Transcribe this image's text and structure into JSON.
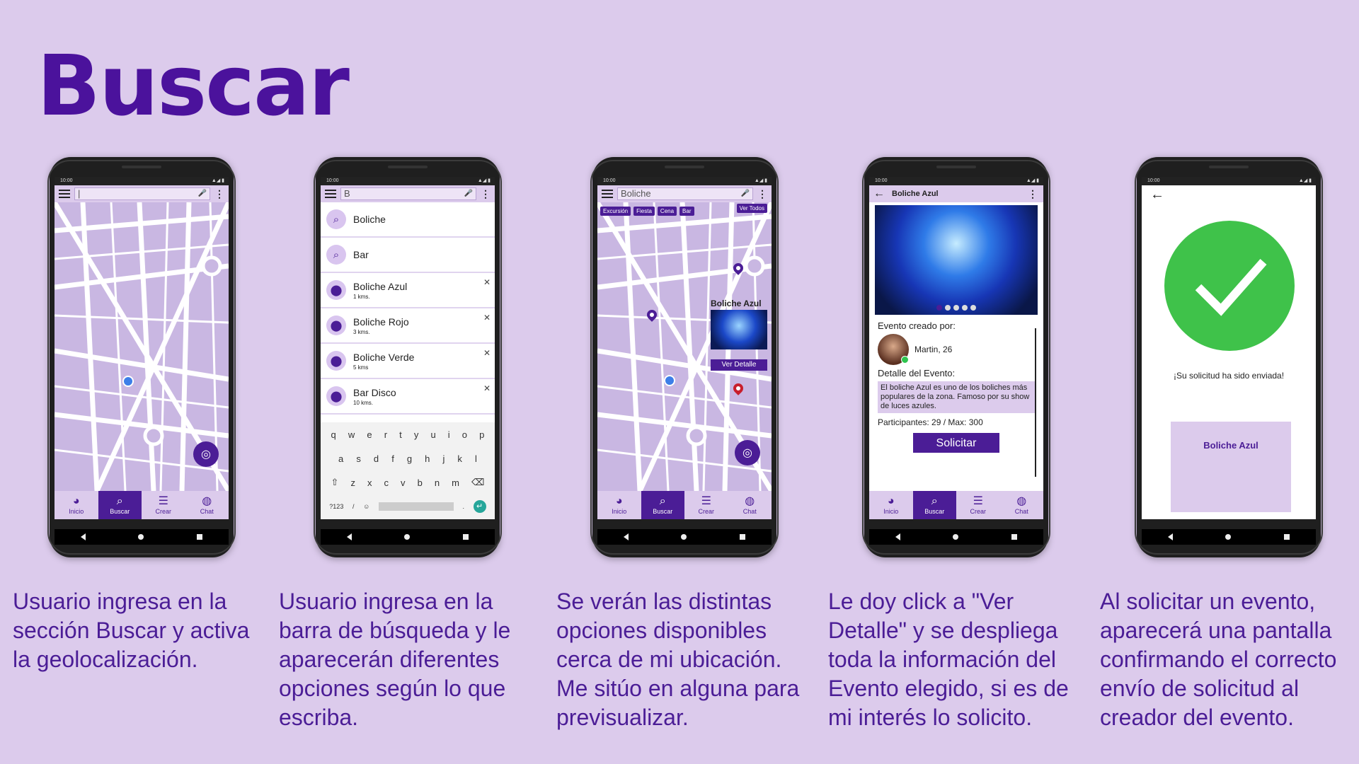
{
  "page_title": "Buscar",
  "captions": [
    "Usuario ingresa en la sección Buscar y activa la geolocalización.",
    "Usuario ingresa en la barra de búsqueda y le aparecerán diferentes opciones según lo que escriba.",
    "Se verán las distintas opciones disponibles cerca de mi ubicación. Me sitúo en alguna para previsualizar.",
    "Le doy click a \"Ver Detalle\" y se despliega toda la información del Evento elegido, si es de mi interés lo solicito.",
    "Al solicitar un evento, aparecerá una pantalla confirmando el correcto envío de solicitud al creador del evento."
  ],
  "status_time": "10:00",
  "bottom_nav": [
    "Inicio",
    "Buscar",
    "Crear",
    "Chat"
  ],
  "phone1": {
    "search_value": "|"
  },
  "phone2": {
    "search_value": "B",
    "suggestions": [
      {
        "label": "Boliche",
        "sub": ""
      },
      {
        "label": "Bar",
        "sub": ""
      },
      {
        "label": "Boliche Azul",
        "sub": "1 kms."
      },
      {
        "label": "Boliche Rojo",
        "sub": "3 kms."
      },
      {
        "label": "Boliche Verde",
        "sub": "5 kms"
      },
      {
        "label": "Bar Disco",
        "sub": "10 kms."
      }
    ],
    "keyboard_rows": [
      [
        "q",
        "w",
        "e",
        "r",
        "t",
        "y",
        "u",
        "i",
        "o",
        "p"
      ],
      [
        "a",
        "s",
        "d",
        "f",
        "g",
        "h",
        "j",
        "k",
        "l"
      ],
      [
        "⇧",
        "z",
        "x",
        "c",
        "v",
        "b",
        "n",
        "m",
        "⌫"
      ],
      [
        "?123",
        "/",
        "☺",
        "",
        ".",
        "↵"
      ]
    ]
  },
  "phone3": {
    "search_value": "Boliche",
    "chips": [
      "Excursión",
      "Fiesta",
      "Cena",
      "Bar"
    ],
    "ver_todos": "Ver Todos",
    "preview_title": "Boliche Azul",
    "ver_detalle": "Ver Detalle"
  },
  "phone4": {
    "header_title": "Boliche Azul",
    "creado_por": "Evento creado por:",
    "creator": "Martin, 26",
    "detalle_label": "Detalle del Evento:",
    "description": "El boliche Azul es uno de los boliches más populares de la zona. Famoso por su show de luces azules.",
    "participantes": "Participantes: 29 / Max: 300",
    "solicitar": "Solicitar"
  },
  "phone5": {
    "confirm_text": "¡Su solicitud ha sido enviada!",
    "card_title": "Boliche Azul"
  }
}
